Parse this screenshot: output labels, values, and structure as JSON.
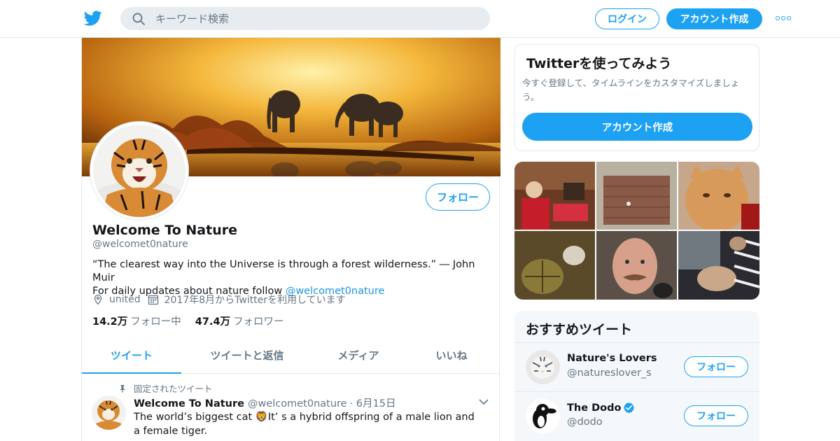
{
  "header": {
    "search_placeholder": "キーワード検索",
    "login_label": "ログイン",
    "signup_label": "アカウント作成"
  },
  "profile": {
    "name": "Welcome To Nature",
    "handle": "@welcomet0nature",
    "bio_line1": "“The clearest way into the Universe is through a forest wilderness.” ― John Muir",
    "bio_line2_prefix": "For daily updates about nature follow ",
    "bio_link": "@welcomet0nature",
    "location": "united",
    "joined": "2017年8月からTwitterを利用しています",
    "following_count": "14.2万",
    "following_label": "フォロー中",
    "followers_count": "47.4万",
    "followers_label": "フォロワー",
    "follow_button": "フォロー"
  },
  "tabs": [
    {
      "label": "ツイート",
      "active": true
    },
    {
      "label": "ツイートと返信",
      "active": false
    },
    {
      "label": "メディア",
      "active": false
    },
    {
      "label": "いいね",
      "active": false
    }
  ],
  "pinned_tweet": {
    "pinned_label": "固定されたツイート",
    "author_name": "Welcome To Nature",
    "author_handle": "@welcomet0nature",
    "date": "· 6月15日",
    "text": "The world’s biggest cat 🦁It’ s a hybrid offspring of a male lion and a female tiger."
  },
  "signup_card": {
    "title": "Twitterを使ってみよう",
    "description": "今すぐ登録して、タイムラインをカスタマイズしましょう。",
    "button": "アカウント作成"
  },
  "recommended": {
    "title": "おすすめツイート",
    "accounts": [
      {
        "name": "Nature's Lovers",
        "handle": "@natureslover_s",
        "verified": false,
        "follow_label": "フォロー"
      },
      {
        "name": "The Dodo",
        "handle": "@dodo",
        "verified": true,
        "follow_label": "フォロー"
      }
    ]
  },
  "colors": {
    "accent": "#1da1f2",
    "text_secondary": "#657786",
    "border": "#e1e8ed"
  }
}
